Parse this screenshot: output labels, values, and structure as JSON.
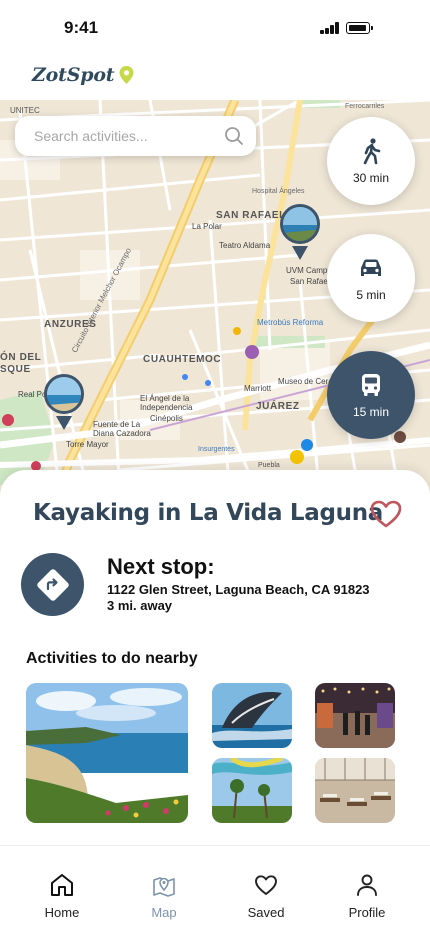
{
  "status_bar": {
    "time": "9:41"
  },
  "app": {
    "name": "ZotSpot",
    "accent": "#c5d94a",
    "primary": "#3e546b"
  },
  "search": {
    "placeholder": "Search activities..."
  },
  "map": {
    "labels": {
      "unitec": "UNITEC",
      "san_rafael": "SAN RAFAEL",
      "anzures": "ANZURES",
      "cuauhtemoc": "CUAUHTEMOC",
      "juarez": "JUÁREZ",
      "la_polar": "La Polar",
      "teatro": "Teatro Aldama",
      "uvm": "UVM Campus",
      "uvm2": "San Rafael",
      "metrobus": "Metrobús Reforma",
      "marriott": "Marriott",
      "museo": "Museo de Cera",
      "angel": "El Ángel de la",
      "angel2": "Independencia",
      "fuente": "Fuente de La",
      "fuente2": "Diana Cazadora",
      "cinepolis": "Cinépolis",
      "torre": "Torre Mayor",
      "polanco": "Real Polanco",
      "on_del": "ÓN DEL",
      "sque": "SQUE",
      "insurgentes": "Insurgentes",
      "puebla": "Puebla",
      "circuito": "Circuito Interior Melchor Ocampo"
    }
  },
  "transport_modes": [
    {
      "name": "walk",
      "icon": "walk-icon",
      "time": "30 min",
      "active": false
    },
    {
      "name": "car",
      "icon": "car-icon",
      "time": "5 min",
      "active": false
    },
    {
      "name": "bus",
      "icon": "bus-icon",
      "time": "15 min",
      "active": true
    }
  ],
  "activity": {
    "title": "Kayaking in La Vida Laguna",
    "next_stop_label": "Next stop:",
    "address": "1122 Glen Street, Laguna Beach, CA 91823",
    "distance": "3 mi. away",
    "favorite_color": "#c0555c"
  },
  "nearby": {
    "heading": "Activities to do nearby",
    "items": [
      {
        "icon": "coastline-photo"
      },
      {
        "icon": "whale-photo"
      },
      {
        "icon": "market-photo"
      },
      {
        "icon": "palms-photo"
      },
      {
        "icon": "restaurant-photo"
      }
    ]
  },
  "nav": {
    "items": [
      {
        "label": "Home",
        "icon": "home-icon",
        "active": false
      },
      {
        "label": "Map",
        "icon": "map-icon",
        "active": true
      },
      {
        "label": "Saved",
        "icon": "heart-icon",
        "active": false
      },
      {
        "label": "Profile",
        "icon": "profile-icon",
        "active": false
      }
    ]
  }
}
